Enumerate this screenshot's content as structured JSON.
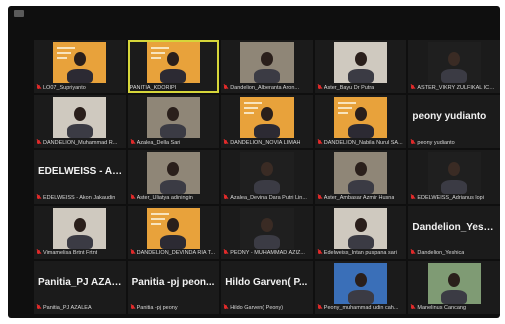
{
  "window": {
    "top_icon": "window-menu-icon"
  },
  "active_speaker_index": 1,
  "participants": [
    {
      "name": "LO07_Supriyanto",
      "mic": "muted",
      "video": true,
      "scene": "orange-poster"
    },
    {
      "name": "PANITIA_KDORIPI",
      "mic": "on",
      "video": true,
      "scene": "orange-poster"
    },
    {
      "name": "Dandelion_Alberanta Aron...",
      "mic": "muted",
      "video": true,
      "scene": "room"
    },
    {
      "name": "Aster_Bayu Dr Putra",
      "mic": "muted",
      "video": true,
      "scene": "light"
    },
    {
      "name": "ASTER_VIKRY ZULFIKAL ICHWA...",
      "mic": "muted",
      "video": true,
      "scene": "dark"
    },
    {
      "name": "DANDELION_Muhammad R...",
      "mic": "muted",
      "video": true,
      "scene": "light"
    },
    {
      "name": "Azalea_Della Sari",
      "mic": "muted",
      "video": true,
      "scene": "room"
    },
    {
      "name": "DANDELION_NOVIA LIMAH",
      "mic": "muted",
      "video": true,
      "scene": "orange-poster"
    },
    {
      "name": "DANDELION_Nabila Nurul SA...",
      "mic": "muted",
      "video": true,
      "scene": "orange-poster"
    },
    {
      "name": "peony yudianto",
      "mic": "muted",
      "video": false,
      "scene": "dark"
    },
    {
      "name": "EDELWEISS - Akon Jakaudin",
      "mic": "muted",
      "video": false,
      "scene": "dark"
    },
    {
      "name": "Aster_Uliatya adiningin",
      "mic": "muted",
      "video": true,
      "scene": "room"
    },
    {
      "name": "Azalea_Devina Dara Putri Lin...",
      "mic": "muted",
      "video": true,
      "scene": "dark"
    },
    {
      "name": "Aster_Ambasar Azmir Husna",
      "mic": "muted",
      "video": true,
      "scene": "room"
    },
    {
      "name": "EDELWEISS_Adrianus lopi",
      "mic": "muted",
      "video": true,
      "scene": "dark"
    },
    {
      "name": "Vimamelisa Brtnt Frtnt",
      "mic": "muted",
      "video": true,
      "scene": "light"
    },
    {
      "name": "DANDELION_DEVINDA RIA T...",
      "mic": "muted",
      "video": true,
      "scene": "orange-poster"
    },
    {
      "name": "PEONY - MUHAMMAD AZIZ...",
      "mic": "muted",
      "video": true,
      "scene": "dark"
    },
    {
      "name": "Edelweiss_Intan puspana sari",
      "mic": "muted",
      "video": true,
      "scene": "light"
    },
    {
      "name": "Dandelion_Yeshica",
      "mic": "muted",
      "video": false,
      "scene": "dark"
    },
    {
      "name": "Panitia_PJ AZALEA",
      "mic": "muted",
      "video": false,
      "scene": "dark"
    },
    {
      "name": "Panitia -pj peony",
      "mic": "muted",
      "video": false,
      "scene": "dark"
    },
    {
      "name": "Hildo Garven( Peony)",
      "mic": "muted",
      "video": false,
      "scene": "dark"
    },
    {
      "name": "Peony_muhammad udin cah...",
      "mic": "muted",
      "video": true,
      "scene": "blue"
    },
    {
      "name": "Manelinus Cancang",
      "mic": "muted",
      "video": true,
      "scene": "outdoor"
    }
  ],
  "big_names": {
    "9": "peony yudianto",
    "10": "EDELWEISS - Ak...",
    "19": "Dandelion_Yesh...",
    "20": "Panitia_PJ AZAL...",
    "21": "Panitia -pj peon...",
    "22": "Hildo Garven( P..."
  },
  "colors": {
    "accent_speaking": "#d6d63a",
    "mic_muted": "#e02a2a",
    "poster_orange": "#e8a23b"
  }
}
